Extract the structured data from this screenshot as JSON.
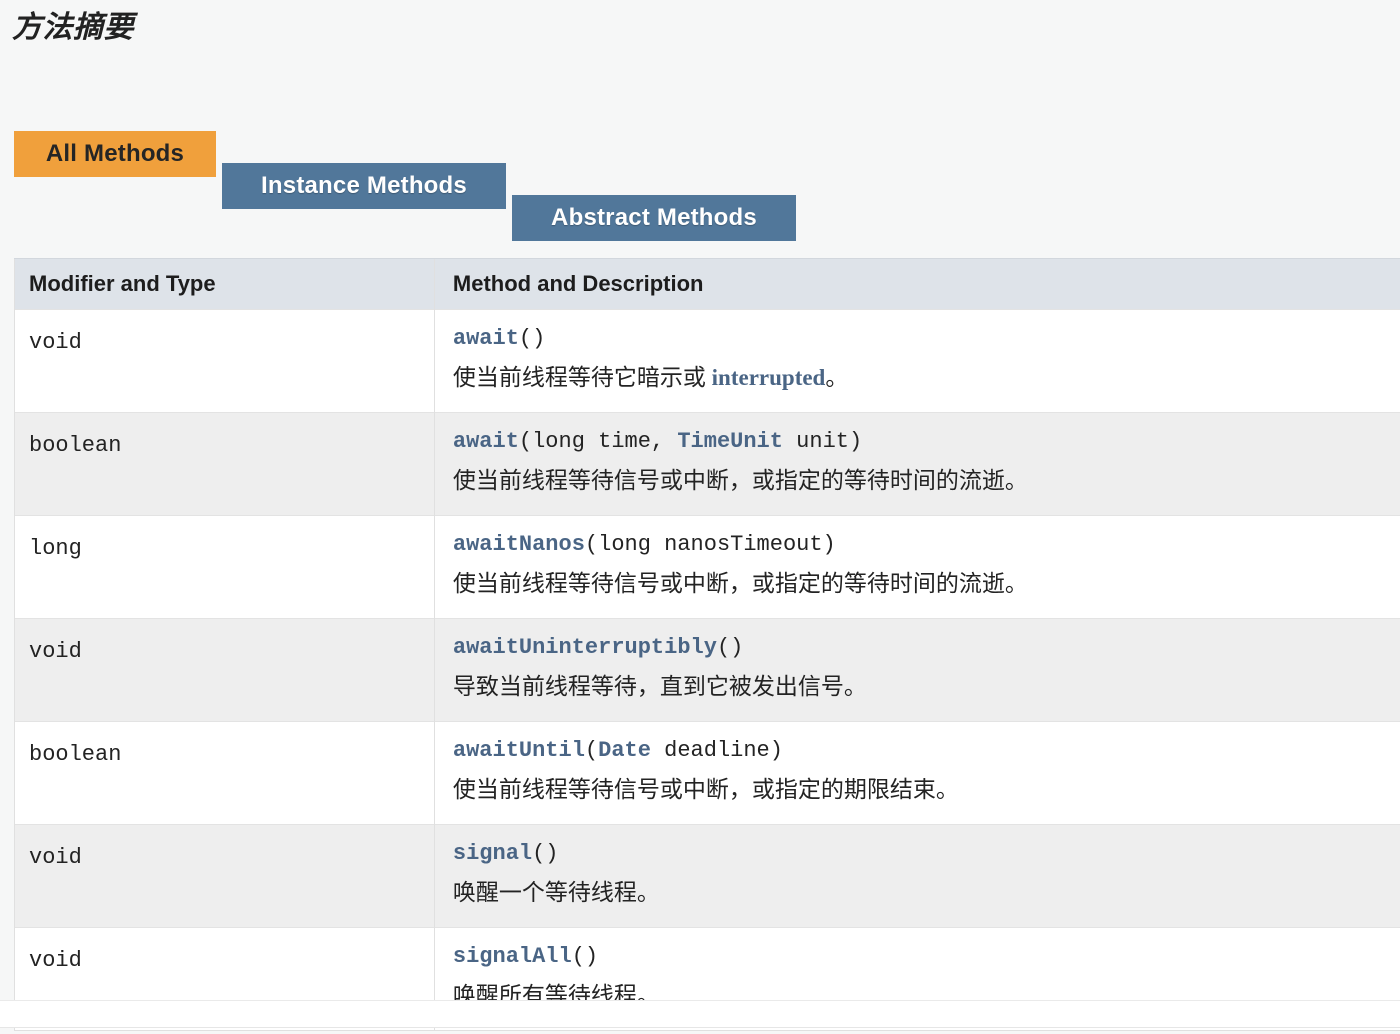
{
  "page": {
    "title": "方法摘要",
    "background_color": "#f6f7f7"
  },
  "tabs": [
    {
      "label": "All Methods",
      "state": "active",
      "background_color": "#f0a03c",
      "text_color": "#252525"
    },
    {
      "label": "Instance Methods",
      "state": "inactive",
      "background_color": "#51779a",
      "text_color": "#ffffff"
    },
    {
      "label": "Abstract Methods",
      "state": "inactive",
      "background_color": "#51779a",
      "text_color": "#ffffff"
    }
  ],
  "table": {
    "headers": {
      "modifier": "Modifier and Type",
      "method": "Method and Description"
    },
    "header_background_color": "#dee3e9",
    "link_color": "#4a6585",
    "rows": [
      {
        "modifier": "void",
        "signature_parts": [
          {
            "text": "await",
            "link": true
          },
          {
            "text": "()",
            "link": false
          }
        ],
        "description_parts": [
          {
            "text": "使当前线程等待它暗示或 ",
            "link": false
          },
          {
            "text": "interrupted",
            "link": true
          },
          {
            "text": "。",
            "link": false
          }
        ]
      },
      {
        "modifier": "boolean",
        "signature_parts": [
          {
            "text": "await",
            "link": true
          },
          {
            "text": "(long time, ",
            "link": false
          },
          {
            "text": "TimeUnit",
            "link": true
          },
          {
            "text": " unit)",
            "link": false
          }
        ],
        "description_parts": [
          {
            "text": "使当前线程等待信号或中断，或指定的等待时间的流逝。",
            "link": false
          }
        ]
      },
      {
        "modifier": "long",
        "signature_parts": [
          {
            "text": "awaitNanos",
            "link": true
          },
          {
            "text": "(long nanosTimeout)",
            "link": false
          }
        ],
        "description_parts": [
          {
            "text": "使当前线程等待信号或中断，或指定的等待时间的流逝。",
            "link": false
          }
        ]
      },
      {
        "modifier": "void",
        "signature_parts": [
          {
            "text": "awaitUninterruptibly",
            "link": true
          },
          {
            "text": "()",
            "link": false
          }
        ],
        "description_parts": [
          {
            "text": "导致当前线程等待，直到它被发出信号。",
            "link": false
          }
        ]
      },
      {
        "modifier": "boolean",
        "signature_parts": [
          {
            "text": "awaitUntil",
            "link": true
          },
          {
            "text": "(",
            "link": false
          },
          {
            "text": "Date",
            "link": true
          },
          {
            "text": " deadline)",
            "link": false
          }
        ],
        "description_parts": [
          {
            "text": "使当前线程等待信号或中断，或指定的期限结束。",
            "link": false
          }
        ]
      },
      {
        "modifier": "void",
        "signature_parts": [
          {
            "text": "signal",
            "link": true
          },
          {
            "text": "()",
            "link": false
          }
        ],
        "description_parts": [
          {
            "text": "唤醒一个等待线程。",
            "link": false
          }
        ]
      },
      {
        "modifier": "void",
        "signature_parts": [
          {
            "text": "signalAll",
            "link": true
          },
          {
            "text": "()",
            "link": false
          }
        ],
        "description_parts": [
          {
            "text": "唤醒所有等待线程。",
            "link": false
          }
        ]
      }
    ]
  }
}
